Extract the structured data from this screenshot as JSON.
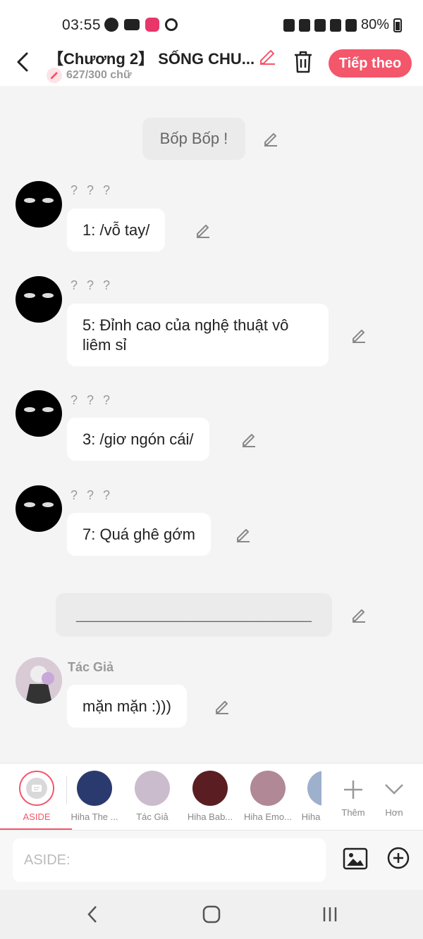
{
  "status_bar": {
    "time": "03:55",
    "battery": "80%"
  },
  "header": {
    "title": "【Chương 2】 SỐNG CHU...",
    "word_count": "627/300 chữ",
    "next_label": "Tiếp theo"
  },
  "messages": [
    {
      "type": "narration",
      "text": "Bốp Bốp !"
    },
    {
      "type": "character",
      "name": "? ? ?",
      "text": "1: /vỗ tay/"
    },
    {
      "type": "character",
      "name": "? ? ?",
      "text": "5: Đỉnh cao của nghệ thuật vô liêm sỉ"
    },
    {
      "type": "character",
      "name": "? ? ?",
      "text": "3: /giơ ngón cái/"
    },
    {
      "type": "character",
      "name": "? ? ?",
      "text": "7: Quá ghê gớm"
    },
    {
      "type": "narration",
      "text": "______________________________"
    },
    {
      "type": "character",
      "name": "Tác Giả",
      "text": "mặn mặn :)))"
    }
  ],
  "characters": [
    {
      "label": "ASIDE"
    },
    {
      "label": "Hiha The ..."
    },
    {
      "label": "Tác Giả"
    },
    {
      "label": "Hiha Bab..."
    },
    {
      "label": "Hiha Emo..."
    },
    {
      "label": "Hiha"
    },
    {
      "label": "Thêm"
    },
    {
      "label": "Hơn"
    }
  ],
  "input": {
    "placeholder": "ASIDE:"
  },
  "colors": {
    "accent": "#f4566b",
    "bg": "#f4f4f4"
  }
}
